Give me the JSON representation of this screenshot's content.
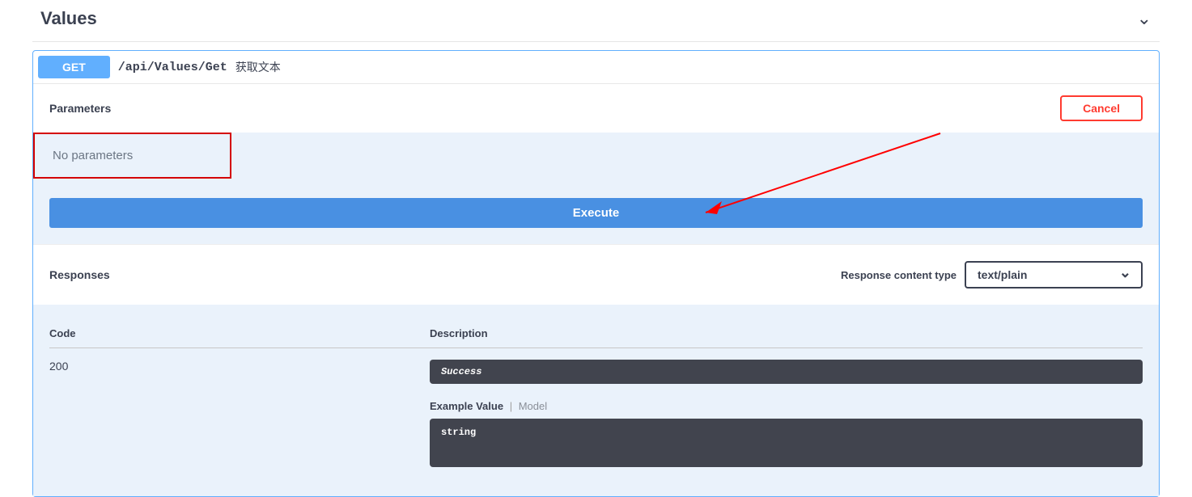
{
  "section": {
    "title": "Values"
  },
  "operation": {
    "method": "GET",
    "path": "/api/Values/Get",
    "summary": "获取文本"
  },
  "parameters": {
    "heading": "Parameters",
    "cancel_label": "Cancel",
    "empty_text": "No parameters"
  },
  "execute": {
    "label": "Execute"
  },
  "responses": {
    "heading": "Responses",
    "content_type_label": "Response content type",
    "content_type_selected": "text/plain",
    "col_code": "Code",
    "col_desc": "Description",
    "rows": [
      {
        "code": "200",
        "description": "Success"
      }
    ],
    "example_label": "Example Value",
    "model_label": "Model",
    "example_body": "string"
  }
}
